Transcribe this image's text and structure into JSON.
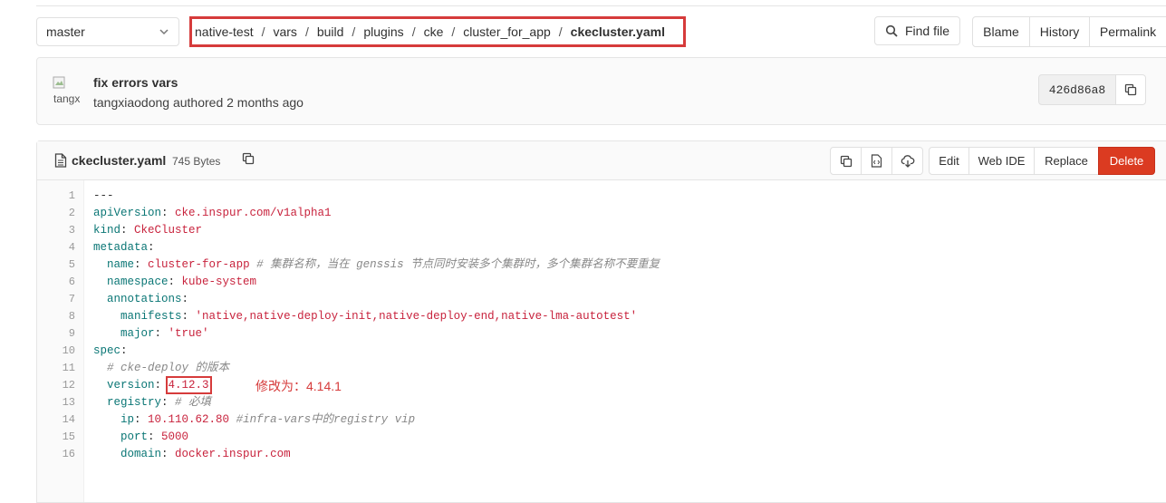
{
  "branch": {
    "value": "master",
    "icon": "chevron-down-icon"
  },
  "breadcrumb": {
    "segments": [
      "native-test",
      "vars",
      "build",
      "plugins",
      "cke",
      "cluster_for_app"
    ],
    "current": "ckecluster.yaml",
    "separator": "/"
  },
  "toolbar": {
    "find_file": "Find file",
    "blame": "Blame",
    "history": "History",
    "permalink": "Permalink"
  },
  "commit": {
    "title": "fix errors vars",
    "author": "tangxiaodong",
    "meta_suffix": "authored 2 months ago",
    "avatar_alt": "tangx",
    "sha": "426d86a8"
  },
  "file": {
    "name": "ckecluster.yaml",
    "size": "745 Bytes",
    "actions": {
      "edit": "Edit",
      "web_ide": "Web IDE",
      "replace": "Replace",
      "delete": "Delete"
    }
  },
  "code_lines": [
    "---",
    "apiVersion: cke.inspur.com/v1alpha1",
    "kind: CkeCluster",
    "metadata:",
    "  name: cluster-for-app # 集群名称，当在 genssis 节点同时安装多个集群时，多个集群名称不要重复",
    "  namespace: kube-system",
    "  annotations:",
    "    manifests: 'native,native-deploy-init,native-deploy-end,native-lma-autotest'",
    "    major: 'true'",
    "spec:",
    "  # cke-deploy 的版本",
    "  version: 4.12.3",
    "  registry: # 必填",
    "    ip: 10.110.62.80 #infra-vars中的registry vip",
    "    port: 5000",
    "    domain: docker.inspur.com"
  ],
  "annotation_note": "修改为：4.14.1",
  "colors": {
    "highlight_red": "#d63b3b",
    "delete_button": "#db3b21",
    "yaml_key": "#0a7675",
    "yaml_value": "#c8233d"
  }
}
